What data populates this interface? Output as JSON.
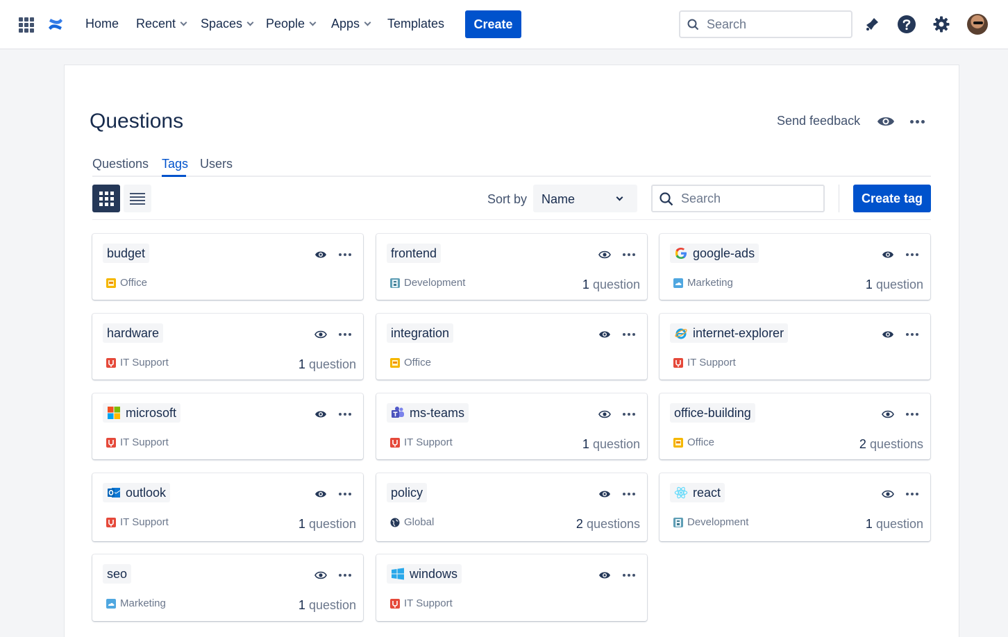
{
  "nav": {
    "items": [
      {
        "label": "Home",
        "dropdown": false
      },
      {
        "label": "Recent",
        "dropdown": true
      },
      {
        "label": "Spaces",
        "dropdown": true
      },
      {
        "label": "People",
        "dropdown": true
      },
      {
        "label": "Apps",
        "dropdown": true
      },
      {
        "label": "Templates",
        "dropdown": false
      }
    ],
    "create_label": "Create",
    "search_placeholder": "Search",
    "icons": [
      "app-switcher-icon",
      "confluence-logo-icon",
      "notifications-icon",
      "help-icon",
      "settings-icon"
    ]
  },
  "page": {
    "title": "Questions",
    "send_feedback": "Send feedback"
  },
  "tabs": [
    {
      "label": "Questions",
      "active": false
    },
    {
      "label": "Tags",
      "active": true
    },
    {
      "label": "Users",
      "active": false
    }
  ],
  "toolbar": {
    "sort_label": "Sort by",
    "sort_value": "Name",
    "search_placeholder": "Search",
    "create_tag_label": "Create tag",
    "view_mode": "grid"
  },
  "colors": {
    "primary": "#0052cc",
    "text": "#172b4d",
    "subtle": "#6b778c",
    "dark_toggle": "#253858"
  },
  "tags": [
    {
      "name": "budget",
      "icon": "none",
      "space": "Office",
      "space_icon": "office",
      "count": "",
      "count_label": "",
      "watched": true
    },
    {
      "name": "frontend",
      "icon": "none",
      "space": "Development",
      "space_icon": "development",
      "count": "1",
      "count_label": "question",
      "watched": false
    },
    {
      "name": "google-ads",
      "icon": "google",
      "space": "Marketing",
      "space_icon": "marketing",
      "count": "1",
      "count_label": "question",
      "watched": true
    },
    {
      "name": "hardware",
      "icon": "none",
      "space": "IT Support",
      "space_icon": "itsupport",
      "count": "1",
      "count_label": "question",
      "watched": false
    },
    {
      "name": "integration",
      "icon": "none",
      "space": "Office",
      "space_icon": "office",
      "count": "",
      "count_label": "",
      "watched": true
    },
    {
      "name": "internet-explorer",
      "icon": "ie",
      "space": "IT Support",
      "space_icon": "itsupport",
      "count": "",
      "count_label": "",
      "watched": true
    },
    {
      "name": "microsoft",
      "icon": "microsoft",
      "space": "IT Support",
      "space_icon": "itsupport",
      "count": "",
      "count_label": "",
      "watched": true
    },
    {
      "name": "ms-teams",
      "icon": "teams",
      "space": "IT Support",
      "space_icon": "itsupport",
      "count": "1",
      "count_label": "question",
      "watched": false
    },
    {
      "name": "office-building",
      "icon": "none",
      "space": "Office",
      "space_icon": "office",
      "count": "2",
      "count_label": "questions",
      "watched": false
    },
    {
      "name": "outlook",
      "icon": "outlook",
      "space": "IT Support",
      "space_icon": "itsupport",
      "count": "1",
      "count_label": "question",
      "watched": true
    },
    {
      "name": "policy",
      "icon": "none",
      "space": "Global",
      "space_icon": "global",
      "count": "2",
      "count_label": "questions",
      "watched": true
    },
    {
      "name": "react",
      "icon": "react",
      "space": "Development",
      "space_icon": "development",
      "count": "1",
      "count_label": "question",
      "watched": false
    },
    {
      "name": "seo",
      "icon": "none",
      "space": "Marketing",
      "space_icon": "marketing",
      "count": "1",
      "count_label": "question",
      "watched": false
    },
    {
      "name": "windows",
      "icon": "windows",
      "space": "IT Support",
      "space_icon": "itsupport",
      "count": "",
      "count_label": "",
      "watched": true
    }
  ]
}
